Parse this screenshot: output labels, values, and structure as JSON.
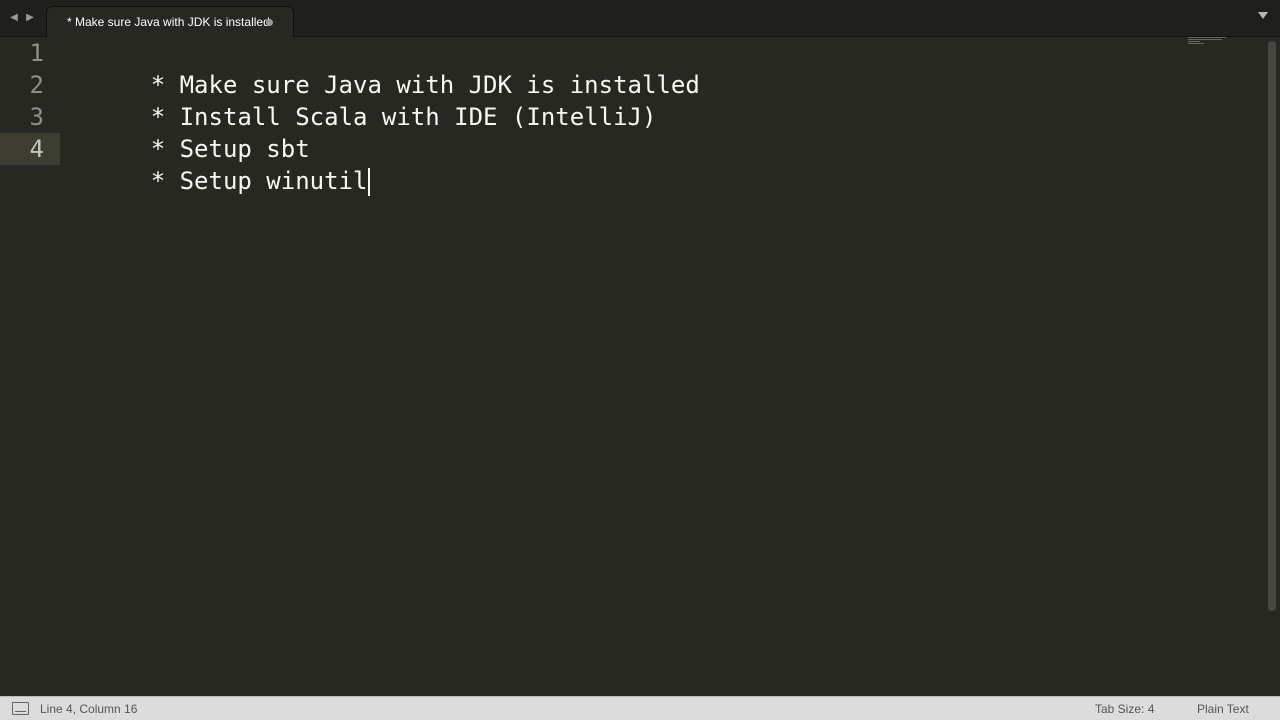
{
  "tabbar": {
    "back_icon": "caret-left-icon",
    "forward_icon": "caret-right-icon",
    "tab_title": "* Make sure Java with JDK is installed",
    "dirty_indicator_icon": "dot-icon",
    "menu_icon": "triangle-down-icon"
  },
  "editor": {
    "lines": [
      {
        "number": "1",
        "text": "* Make sure Java with JDK is installed"
      },
      {
        "number": "2",
        "text": "* Install Scala with IDE (IntelliJ)"
      },
      {
        "number": "3",
        "text": "* Setup sbt"
      },
      {
        "number": "4",
        "text": "* Setup winutil"
      }
    ],
    "current_line": 4
  },
  "statusbar": {
    "position": "Line 4, Column 16",
    "tab_size": "Tab Size: 4",
    "syntax": "Plain Text"
  },
  "colors": {
    "editor_bg": "#272822",
    "text": "#f8f8f2",
    "gutter_text": "#8f908a",
    "statusbar_bg": "#dcdcdc"
  }
}
